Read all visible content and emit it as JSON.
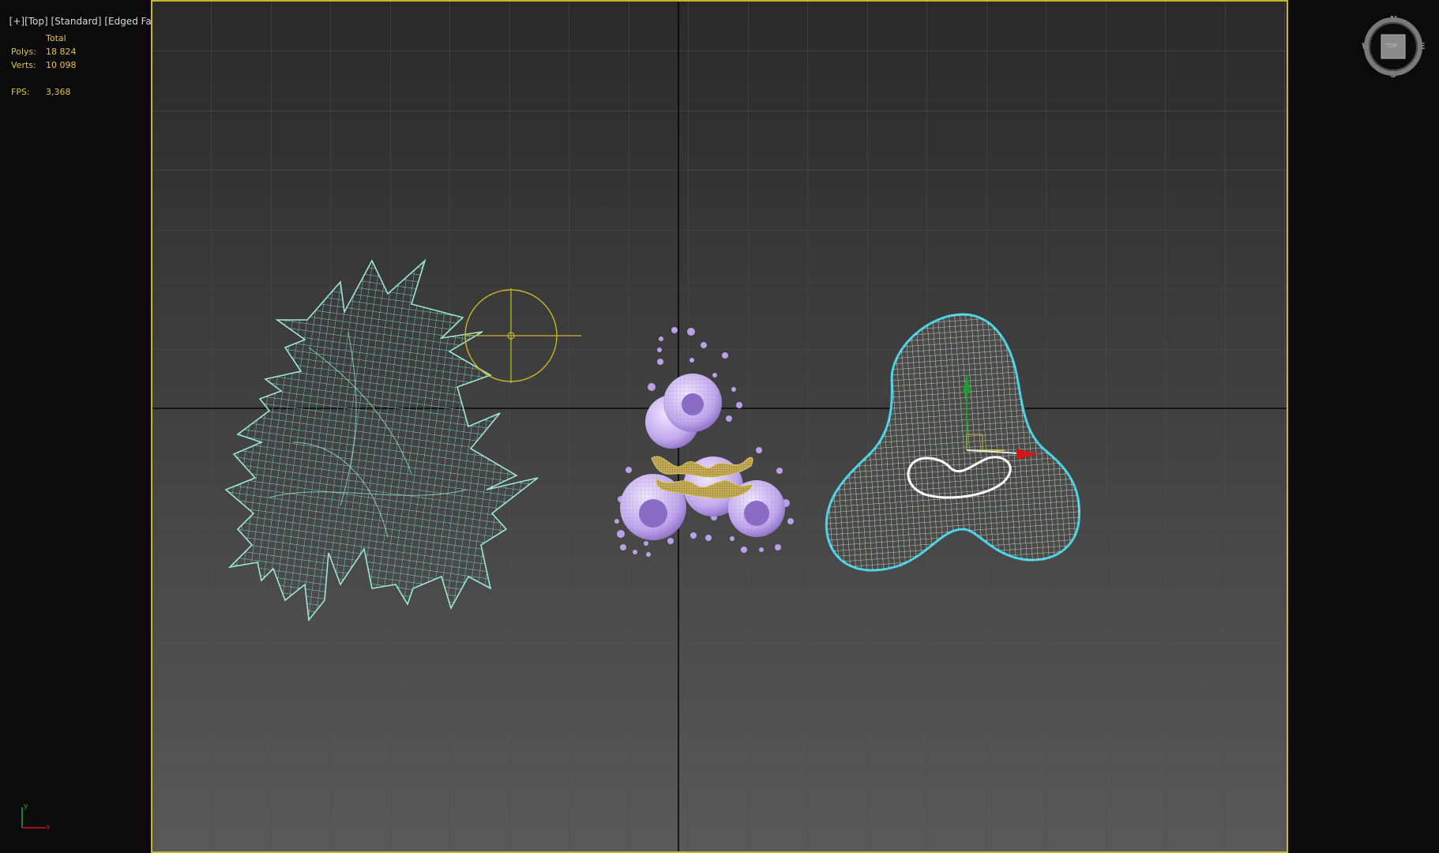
{
  "viewport": {
    "label_parts": [
      "[+]",
      "[Top]",
      "[Standard]",
      "[Edged Faces]"
    ]
  },
  "stats": {
    "header": "Total",
    "polys_label": "Polys:",
    "polys_value": "18 824",
    "verts_label": "Verts:",
    "verts_value": "10 098",
    "fps_label": "FPS:",
    "fps_value": "3,368"
  },
  "viewcube": {
    "n": "N",
    "s": "S",
    "e": "E",
    "w": "W",
    "face": "TOP"
  },
  "axis_tripod": {
    "x": "x",
    "y": "y"
  },
  "colors": {
    "frame": "#c9b52a",
    "spiky_mesh": "#7fd6c0",
    "particles": "#b9a0e8",
    "gold_mesh": "#c8b05a",
    "blob_mesh": "#e4f0d8",
    "blob_outline": "#46d2e6",
    "gizmo_x": "#d01818",
    "gizmo_y": "#1aa02a"
  }
}
